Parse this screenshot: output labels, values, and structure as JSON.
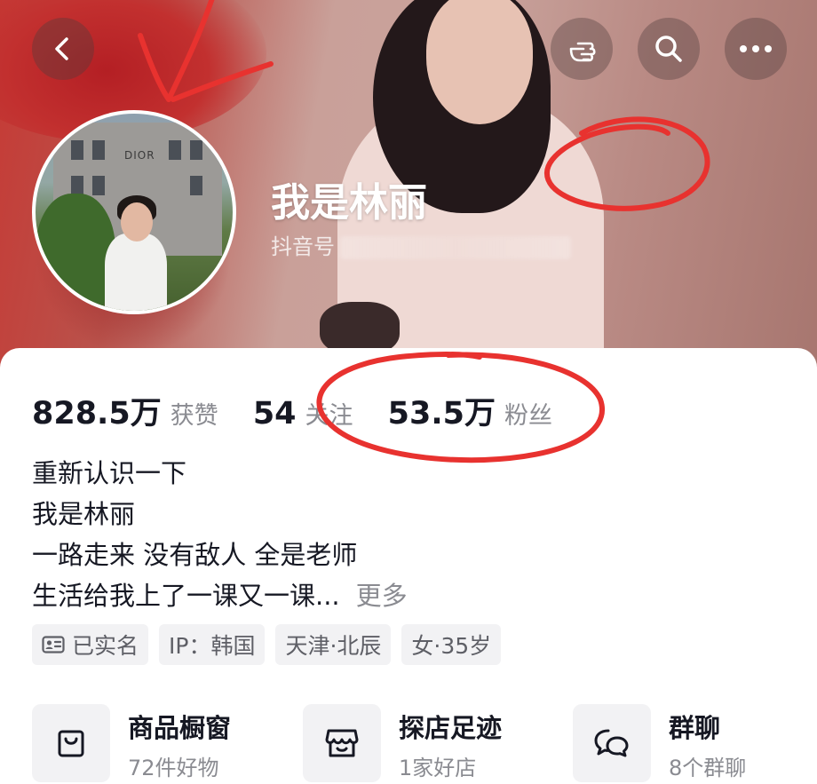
{
  "profile": {
    "name": "我是林丽",
    "id_label": "抖音号"
  },
  "stats": {
    "likes": {
      "value": "828.5万",
      "label": "获赞"
    },
    "following": {
      "value": "54",
      "label": "关注"
    },
    "followers": {
      "value": "53.5万",
      "label": "粉丝"
    }
  },
  "bio": {
    "lines": [
      "重新认识一下",
      "我是林丽",
      "一路走来 没有敌人 全是老师",
      "生活给我上了一课又一课..."
    ],
    "more": "更多"
  },
  "tags": [
    "已实名",
    "IP：韩国",
    "天津·北辰",
    "女·35岁"
  ],
  "cards": [
    {
      "title": "商品橱窗",
      "subtitle": "72件好物",
      "icon": "shopping-bag-icon"
    },
    {
      "title": "探店足迹",
      "subtitle": "1家好店",
      "icon": "store-icon"
    },
    {
      "title": "群聊",
      "subtitle": "8个群聊",
      "icon": "chat-bubbles-icon"
    }
  ],
  "avatar_text": "DIOR",
  "colors": {
    "annotation": "#e8322f",
    "accent_text": "#161823",
    "secondary_text": "#8a8b91"
  }
}
